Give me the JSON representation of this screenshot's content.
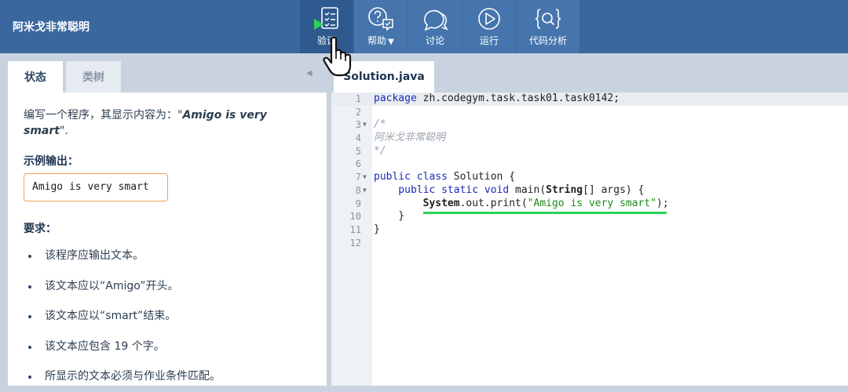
{
  "app": {
    "title": "阿米戈非常聪明"
  },
  "toolbar": {
    "items": [
      {
        "label": "验证",
        "icon": "checklist-play-icon"
      },
      {
        "label": "帮助",
        "icon": "help-chat-icon"
      },
      {
        "label": "讨论",
        "icon": "discussion-icon"
      },
      {
        "label": "运行",
        "icon": "run-play-icon"
      },
      {
        "label": "代码分析",
        "icon": "code-analysis-icon"
      }
    ]
  },
  "left": {
    "tabs": [
      "状态",
      "类树"
    ],
    "description_prefix": "编写一个程序，其显示内容为：\"",
    "description_quote": "Amigo is very smart",
    "description_suffix": "\".",
    "sample_heading": "示例输出：",
    "sample_output": "Amigo is very smart",
    "requirements_heading": "要求：",
    "requirements": [
      "该程序应输出文本。",
      "该文本应以“Amigo”开头。",
      "该文本应以“smart”结束。",
      "该文本应包含 19 个字。",
      "所显示的文本必须与作业条件匹配。"
    ]
  },
  "editor": {
    "file_tab": "Solution.java",
    "line_numbers": [
      "1",
      "2",
      "3",
      "4",
      "5",
      "6",
      "7",
      "8",
      "9",
      "10",
      "11",
      "12"
    ],
    "code": {
      "l1_kw": "package",
      "l1_rest": " zh.codegym.task.task01.task0142;",
      "l3": "/*",
      "l4": "阿米戈非常聪明",
      "l5": "*/",
      "l7_kw": "public class",
      "l7_rest": " Solution {",
      "l8_kw": "    public static void",
      "l8_a": " main(",
      "l8_type": "String",
      "l8_b": "[] args) {",
      "l9_type": "        System",
      "l9_a": ".out.print(",
      "l9_str": "\"Amigo is very smart\"",
      "l9_b": ");",
      "l10": "    }",
      "l11": "}"
    }
  },
  "colors": {
    "topbar": "#3a679e",
    "button": "#4675ad",
    "underline": "#2ed158",
    "sample_border": "#f0a44c"
  }
}
